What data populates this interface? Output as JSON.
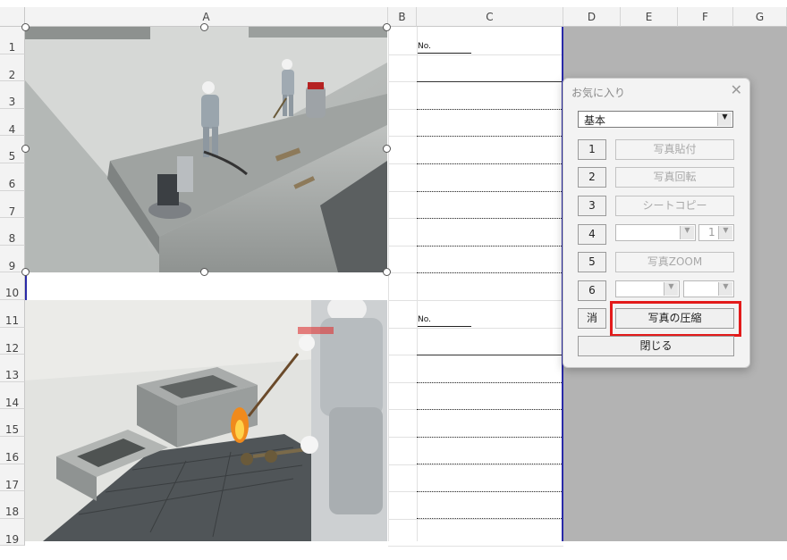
{
  "columns": [
    "A",
    "B",
    "C",
    "D",
    "E",
    "F",
    "G"
  ],
  "rows": [
    "1",
    "2",
    "3",
    "4",
    "5",
    "6",
    "7",
    "8",
    "9",
    "10",
    "11",
    "12",
    "13",
    "14",
    "15",
    "16",
    "17",
    "18",
    "19"
  ],
  "sheet": {
    "no_label_1": "No.",
    "no_label_2": "No."
  },
  "dialog": {
    "title": "お気に入り",
    "close_glyph": "✕",
    "preset_select": "基本",
    "buttons": [
      {
        "num": "1",
        "label": "写真貼付"
      },
      {
        "num": "2",
        "label": "写真回転"
      },
      {
        "num": "3",
        "label": "シートコピー"
      },
      {
        "num": "4"
      },
      {
        "num": "5",
        "label": "写真ZOOM"
      },
      {
        "num": "6"
      }
    ],
    "row4_spin_value": "1",
    "clear_button": "消",
    "compress_button": "写真の圧縮",
    "close_button": "閉じる"
  },
  "colors": {
    "highlight": "#e31b1b",
    "selection_border": "#2a2aa8",
    "out_of_print_area": "#b3b3b3"
  }
}
